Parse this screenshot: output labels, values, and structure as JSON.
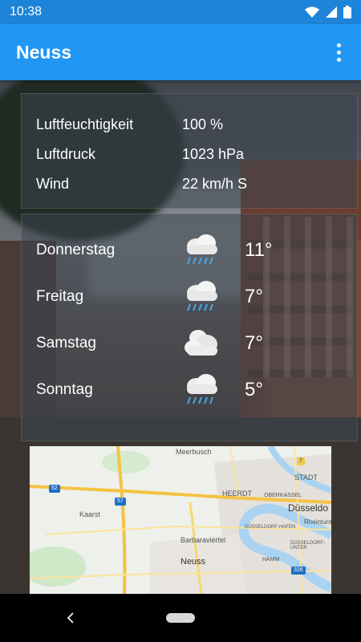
{
  "status_bar": {
    "time": "10:38"
  },
  "app_bar": {
    "title": "Neuss"
  },
  "details": [
    {
      "label": "Luftfeuchtigkeit",
      "value": "100 %"
    },
    {
      "label": "Luftdruck",
      "value": "1023 hPa"
    },
    {
      "label": "Wind",
      "value": "22 km/h S"
    }
  ],
  "forecast": [
    {
      "day": "Donnerstag",
      "icon": "rain-cloud-icon",
      "temp": "11°"
    },
    {
      "day": "Freitag",
      "icon": "rain-cloud-icon",
      "temp": "7°"
    },
    {
      "day": "Samstag",
      "icon": "cloud-icon",
      "temp": "7°"
    },
    {
      "day": "Sonntag",
      "icon": "rain-cloud-icon",
      "temp": "5°"
    }
  ],
  "map": {
    "labels": {
      "meerbusch": "Meerbusch",
      "heerdt": "HEERDT",
      "oberkassel": "OBERKASSEL",
      "duesseldorf": "Düsseldo",
      "kaarst": "Kaarst",
      "duesseldorf_hafen": "DÜSSELDORF-HAFEN",
      "barbaraviertel": "Barbaraviertel",
      "neuss": "Neuss",
      "hamm": "HAMM",
      "rheinturm": "Rheinturm",
      "stadt": "STADT",
      "duesseldorf_unter": "DÜSSELDORF-UNTER"
    },
    "road_badges": {
      "a52": "52",
      "a57": "57",
      "b7": "7",
      "b326": "326"
    }
  },
  "colors": {
    "primary": "#2196f3",
    "status_bar": "#1e84d9"
  }
}
